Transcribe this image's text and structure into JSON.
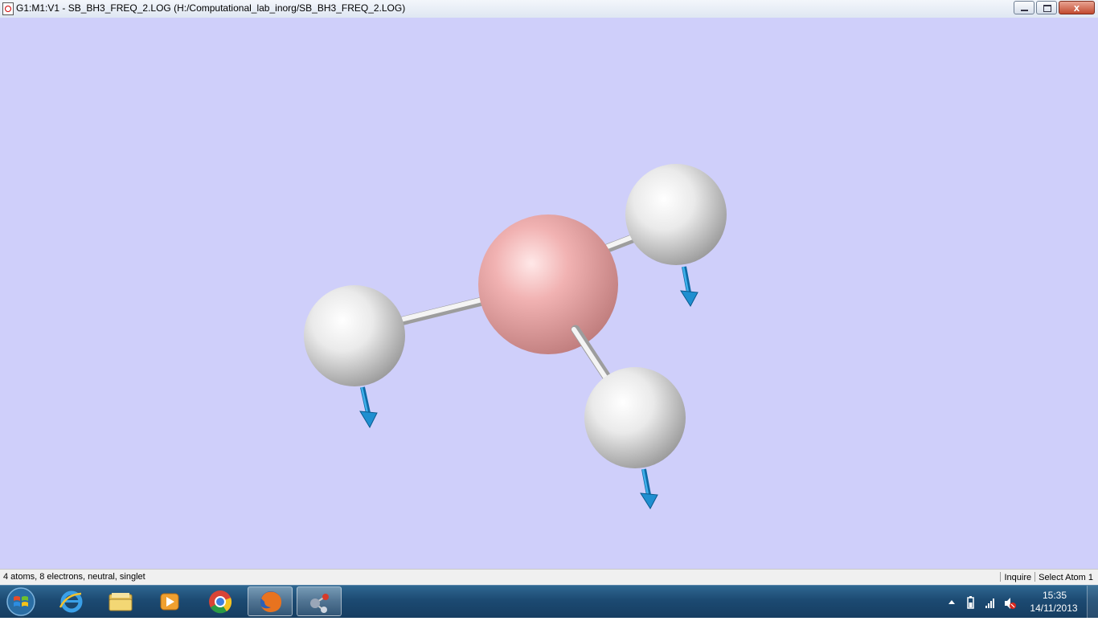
{
  "window": {
    "title": "G1:M1:V1 - SB_BH3_FREQ_2.LOG (H:/Computational_lab_inorg/SB_BH3_FREQ_2.LOG)",
    "buttons": {
      "minimize": "minimize",
      "maximize": "maximize",
      "close": "x"
    }
  },
  "viewport": {
    "background": "#cfcffa",
    "molecule": {
      "atoms": [
        {
          "element": "B",
          "color": "#f0a8a8"
        },
        {
          "element": "H",
          "color": "#f2f2f2"
        },
        {
          "element": "H",
          "color": "#f2f2f2"
        },
        {
          "element": "H",
          "color": "#f2f2f2"
        }
      ],
      "displacement_vector_color": "#1e8fd0"
    }
  },
  "statusbar": {
    "info": "4 atoms, 8 electrons, neutral, singlet",
    "mode": "Inquire",
    "selection": "Select Atom 1"
  },
  "taskbar": {
    "start_icon": "windows-logo-icon",
    "pinned": [
      {
        "icon": "internet-explorer-icon"
      },
      {
        "icon": "file-explorer-icon"
      },
      {
        "icon": "media-player-icon"
      },
      {
        "icon": "chrome-icon"
      },
      {
        "icon": "firefox-icon"
      },
      {
        "icon": "gaussview-icon"
      }
    ],
    "tray": {
      "time": "15:35",
      "date": "14/11/2013"
    }
  }
}
